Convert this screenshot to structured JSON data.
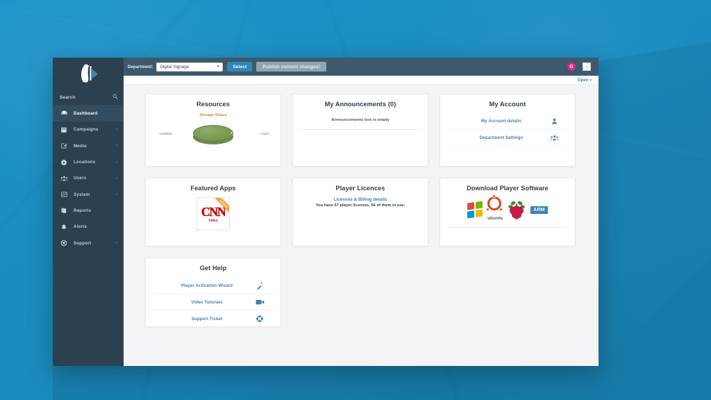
{
  "desktop": {
    "background_color": "#1c8fc4"
  },
  "brand": {
    "logo_name": "play-flame-logo",
    "accent_blue": "#2f87b8"
  },
  "sidebar": {
    "search": {
      "label": "Search",
      "icon": "search-icon"
    },
    "items": [
      {
        "label": "Dashboard",
        "icon": "dashboard-icon",
        "active": true,
        "caret": ""
      },
      {
        "label": "Campaigns",
        "icon": "calendar-icon",
        "active": false,
        "caret": "‹"
      },
      {
        "label": "Media",
        "icon": "edit-square-icon",
        "active": false,
        "caret": "‹"
      },
      {
        "label": "Locations",
        "icon": "play-circle-icon",
        "active": false,
        "caret": "‹"
      },
      {
        "label": "Users",
        "icon": "users-icon",
        "active": false,
        "caret": "‹"
      },
      {
        "label": "System",
        "icon": "chart-icon",
        "active": false,
        "caret": "‹"
      },
      {
        "label": "Reports",
        "icon": "copy-icon",
        "active": false,
        "caret": ""
      },
      {
        "label": "Alerts",
        "icon": "bell-icon",
        "active": false,
        "caret": ""
      },
      {
        "label": "Support",
        "icon": "lifering-icon",
        "active": false,
        "caret": "‹"
      }
    ]
  },
  "topbar": {
    "department_label": "Department:",
    "department_value": "Digital Signage",
    "department_options": [
      "Digital Signage"
    ],
    "select_button": "Select",
    "publish_button": "Publish content changes!",
    "avatar_initial": "G",
    "avatar_color": "#e0218a",
    "grid_icon": "apps-grid-icon"
  },
  "subbar": {
    "open_label": "Open",
    "open_caret": "▾"
  },
  "cards": {
    "resources": {
      "title": "Resources",
      "storage_label": "Storage Status",
      "left_label": "Available",
      "right_label": "Used"
    },
    "announcements": {
      "title": "My Announcements (0)",
      "empty_text": "Announcements box is empty"
    },
    "account": {
      "title": "My Account",
      "rows": [
        {
          "label": "My Account details",
          "icon": "user-icon"
        },
        {
          "label": "Department Settings",
          "icon": "users-group-icon"
        }
      ]
    },
    "featured_apps": {
      "title": "Featured Apps",
      "app_name": "CNN",
      "app_sub": "Video",
      "ribbon": "HTML5"
    },
    "player_licences": {
      "title": "Player Licences",
      "link": "Licenses & Billing details",
      "note": "You have 57 player licenses, 56 of them in use."
    },
    "download": {
      "title": "Download Player Software",
      "platforms": [
        {
          "name": "Windows",
          "icon": "windows-icon"
        },
        {
          "name": "ubuntu",
          "icon": "ubuntu-icon"
        },
        {
          "name": "Raspberry Pi",
          "icon": "raspberry-pi-icon"
        },
        {
          "name": "ARM",
          "icon": "arm-icon"
        }
      ]
    },
    "get_help": {
      "title": "Get Help",
      "rows": [
        {
          "label": "Player Activation Wizard",
          "icon": "magic-wand-icon"
        },
        {
          "label": "Video Tutorials",
          "icon": "video-camera-icon"
        },
        {
          "label": "Support Ticket",
          "icon": "lifering-icon"
        }
      ]
    }
  },
  "chart_data": {
    "type": "pie",
    "title": "Storage Status",
    "categories": [
      "Available",
      "Used"
    ],
    "values": [
      99,
      1
    ],
    "colors": [
      "#7e9d57",
      "#c2cf9f"
    ],
    "legend": "labels-with-leader-lines",
    "style": "3d-pie"
  }
}
